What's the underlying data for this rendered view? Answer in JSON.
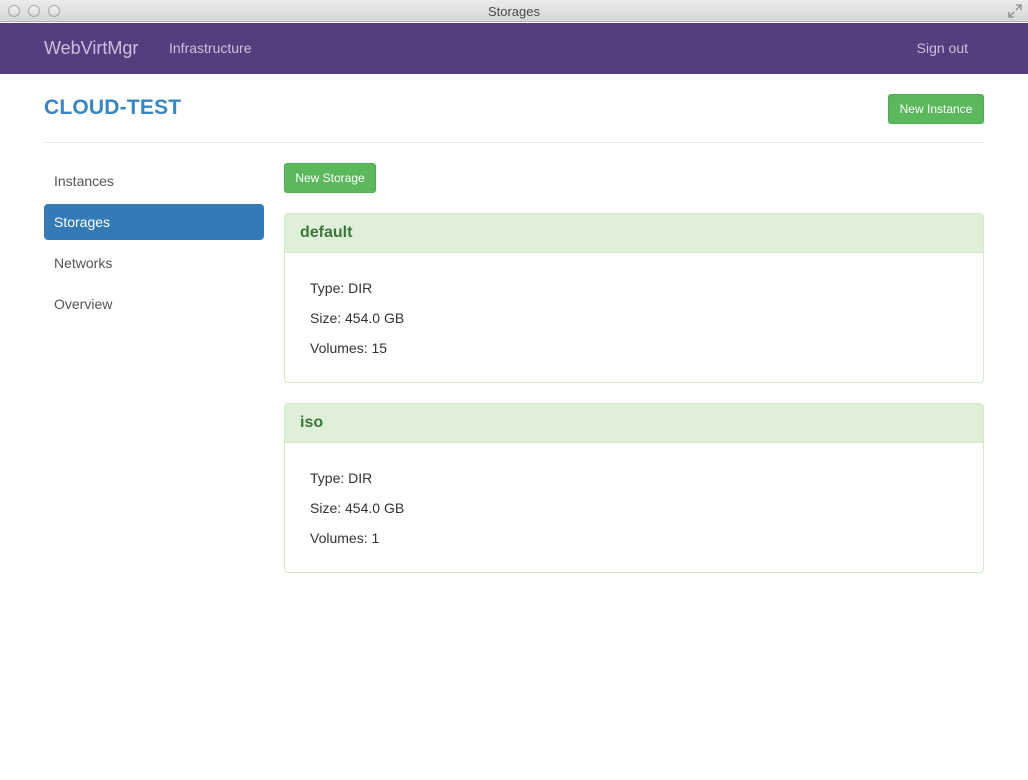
{
  "window": {
    "title": "Storages"
  },
  "navbar": {
    "brand": "WebVirtMgr",
    "infrastructure": "Infrastructure",
    "sign_out": "Sign out"
  },
  "header": {
    "title": "CLOUD-TEST",
    "new_instance": "New Instance"
  },
  "sidebar": {
    "items": [
      {
        "label": "Instances",
        "active": false
      },
      {
        "label": "Storages",
        "active": true
      },
      {
        "label": "Networks",
        "active": false
      },
      {
        "label": "Overview",
        "active": false
      }
    ]
  },
  "main": {
    "new_storage": "New Storage",
    "storages": [
      {
        "name": "default",
        "type": "Type: DIR",
        "size": "Size: 454.0 GB",
        "volumes": "Volumes: 15"
      },
      {
        "name": "iso",
        "type": "Type: DIR",
        "size": "Size: 454.0 GB",
        "volumes": "Volumes: 1"
      }
    ]
  },
  "colors": {
    "navbar": "#563d7c",
    "accent": "#337ab7",
    "success": "#5cb85c",
    "panel_heading": "#dff0d8"
  }
}
